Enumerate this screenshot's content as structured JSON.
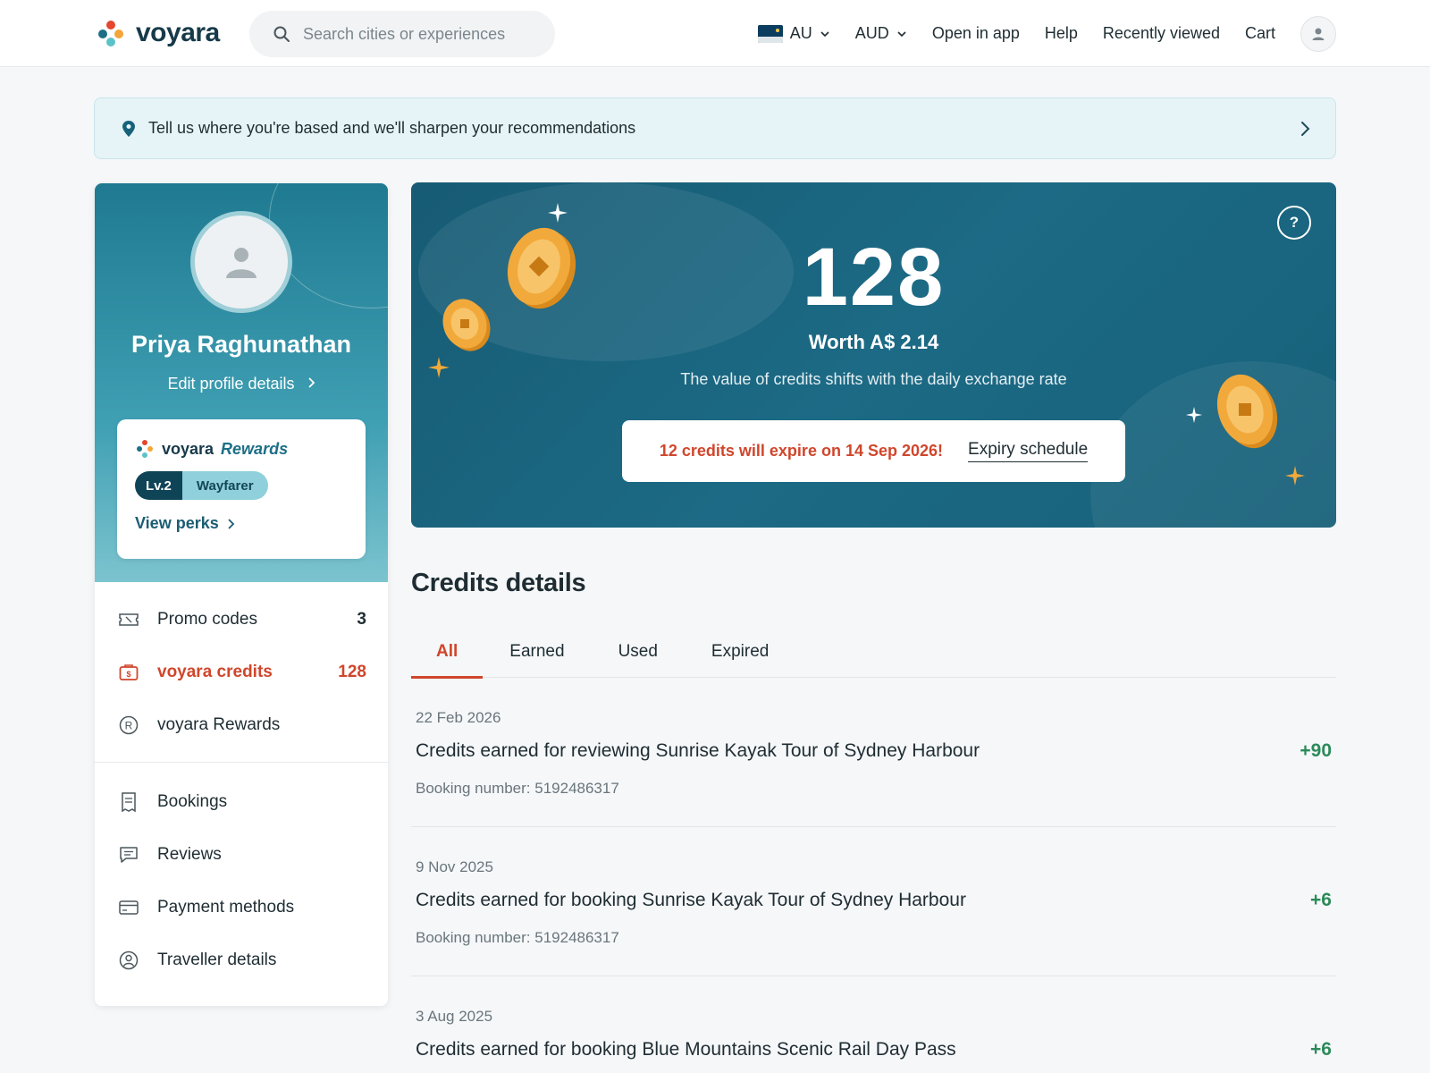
{
  "header": {
    "logo_text": "voyara",
    "search_placeholder": "Search cities or experiences",
    "region": "AU",
    "currency": "AUD",
    "nav": [
      "Open in app",
      "Help",
      "Recently viewed",
      "Cart"
    ]
  },
  "banner": {
    "text": "Tell us where you're based and we'll sharpen your recommendations"
  },
  "profile": {
    "name": "Priya Raghunathan",
    "edit_label": "Edit profile details",
    "rewards_brand": "voyara",
    "rewards_label": "Rewards",
    "level": "Lv.2",
    "tier": "Wayfarer",
    "perks_label": "View perks"
  },
  "menu": {
    "group1": [
      {
        "label": "Promo codes",
        "count": "3",
        "icon": "ticket-icon"
      },
      {
        "label": "voyara credits",
        "count": "128",
        "icon": "wallet-icon"
      },
      {
        "label": "voyara Rewards",
        "count": "",
        "icon": "registered-icon"
      }
    ],
    "group2": [
      {
        "label": "Bookings",
        "icon": "receipt-icon"
      },
      {
        "label": "Reviews",
        "icon": "chat-icon"
      },
      {
        "label": "Payment methods",
        "icon": "card-icon"
      },
      {
        "label": "Traveller details",
        "icon": "person-circle-icon"
      }
    ]
  },
  "hero": {
    "credits": "128",
    "worth": "Worth A$ 2.14",
    "subtitle": "The value of credits shifts with the daily exchange rate",
    "expiry_warning": "12 credits will expire on 14 Sep 2026!",
    "expiry_link": "Expiry schedule",
    "help_symbol": "?"
  },
  "credits_details": {
    "title": "Credits details",
    "tabs": [
      "All",
      "Earned",
      "Used",
      "Expired"
    ],
    "transactions": [
      {
        "date": "22 Feb 2026",
        "description": "Credits earned for reviewing Sunrise Kayak Tour of Sydney Harbour",
        "booking": "Booking number: 5192486317",
        "amount": "+90"
      },
      {
        "date": "9 Nov 2025",
        "description": "Credits earned for booking Sunrise Kayak Tour of Sydney Harbour",
        "booking": "Booking number: 5192486317",
        "amount": "+6"
      },
      {
        "date": "3 Aug 2025",
        "description": "Credits earned for booking Blue Mountains Scenic Rail Day Pass",
        "booking": "",
        "amount": "+6"
      }
    ]
  },
  "colors": {
    "accent": "#d0462c",
    "brand_dark": "#173a4a",
    "teal": "#1c6a85",
    "positive": "#2c8a5a"
  }
}
